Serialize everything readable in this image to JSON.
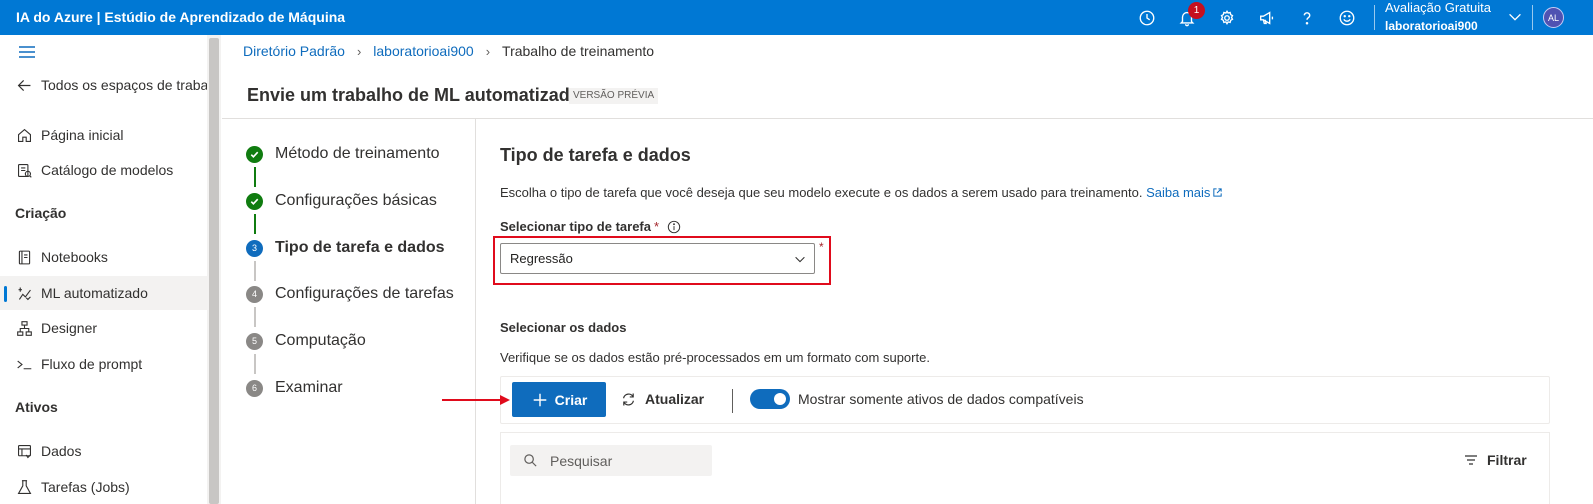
{
  "app": {
    "title": "IA do Azure | Estúdio de Aprendizado de Máquina",
    "notification_count": "1",
    "account_plan": "Avaliação Gratuita",
    "account_workspace": "laboratorioai900",
    "avatar_initials": "AL"
  },
  "sidebar": {
    "back_label": "Todos os espaços de trabal",
    "home": "Página inicial",
    "catalog": "Catálogo de modelos",
    "section_creation": "Criação",
    "notebooks": "Notebooks",
    "automl": "ML automatizado",
    "designer": "Designer",
    "prompt_flow": "Fluxo de prompt",
    "section_assets": "Ativos",
    "data": "Dados",
    "jobs": "Tarefas (Jobs)"
  },
  "breadcrumb": {
    "items": [
      "Diretório Padrão",
      "laboratorioai900",
      "Trabalho de treinamento"
    ]
  },
  "page": {
    "title": "Envie um trabalho de ML automatizado",
    "tag": "VERSÃO PRÉVIA"
  },
  "steps": [
    {
      "label": "Método de treinamento",
      "state": "done",
      "number": ""
    },
    {
      "label": "Configurações básicas",
      "state": "done",
      "number": ""
    },
    {
      "label": "Tipo de tarefa e dados",
      "state": "current",
      "number": "3"
    },
    {
      "label": "Configurações de tarefas",
      "state": "pending",
      "number": "4"
    },
    {
      "label": "Computação",
      "state": "pending",
      "number": "5"
    },
    {
      "label": "Examinar",
      "state": "pending",
      "number": "6"
    }
  ],
  "content": {
    "section_title": "Tipo de tarefa e dados",
    "section_desc": "Escolha o tipo de tarefa que você deseja que seu modelo execute e os dados a serem usado para treinamento.",
    "learn_more": "Saiba mais",
    "task_type_label": "Selecionar tipo de tarefa",
    "required_mark": "*",
    "task_type_value": "Regressão",
    "data_title": "Selecionar os dados",
    "data_desc": "Verifique se os dados estão pré-processados em um formato com suporte.",
    "create_button": "Criar",
    "refresh_button": "Atualizar",
    "toggle_label": "Mostrar somente ativos de dados compatíveis",
    "toggle_on": true,
    "search_placeholder": "Pesquisar",
    "filter_button": "Filtrar"
  },
  "colors": {
    "brand": "#0078d4",
    "accent": "#0f6cbd",
    "done": "#107c10",
    "highlight": "#e00b1c"
  }
}
